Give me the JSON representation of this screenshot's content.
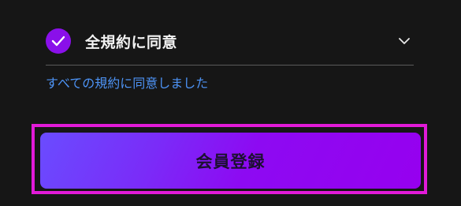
{
  "agreement": {
    "label": "全規約に同意",
    "checked": true,
    "check_icon": "check-icon",
    "expand_icon": "chevron-down-icon",
    "status": "すべての規約に同意しました"
  },
  "register": {
    "label": "会員登録"
  },
  "colors": {
    "background": "#161616",
    "check_accent": "#8a10ea",
    "status_text": "#4d93f5",
    "button_gradient_start": "#6a4cff",
    "button_gradient_end": "#9600ef",
    "highlight_border": "#e21ad8"
  }
}
